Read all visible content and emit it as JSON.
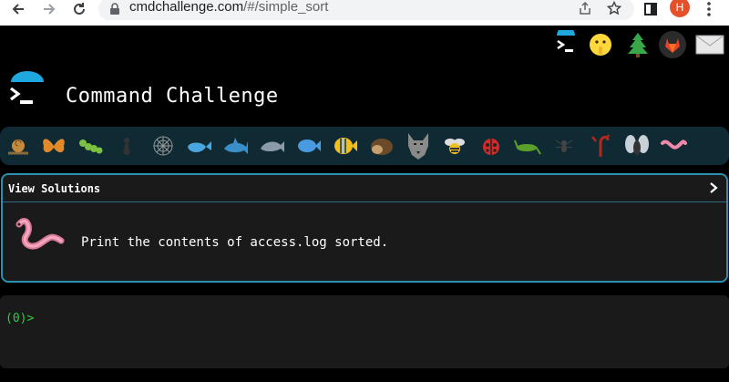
{
  "browser": {
    "url_host": "cmdchallenge.com",
    "url_path": "/#/simple_sort",
    "profile_initial": "H"
  },
  "site": {
    "title": "Command Challenge",
    "header_icons": [
      "terminal-icon",
      "hush-face-icon",
      "tree-icon",
      "gitlab-icon",
      "mail-icon"
    ]
  },
  "levels": [
    "snail",
    "butterfly",
    "caterpillar",
    "ant",
    "spider-web",
    "whale",
    "shark",
    "dolphin",
    "fish",
    "tropical-fish",
    "hedgehog",
    "wolf",
    "bee",
    "ladybug",
    "cricket",
    "spider",
    "scorpion",
    "fly",
    "worm"
  ],
  "challenge": {
    "view_solutions_label": "View Solutions",
    "task": "Print the contents of access.log sorted."
  },
  "terminal": {
    "prompt": "(0)>"
  },
  "colors": {
    "accent": "#2a8fb0",
    "prompt": "#2ecc40",
    "level_bar": "#102a33"
  }
}
